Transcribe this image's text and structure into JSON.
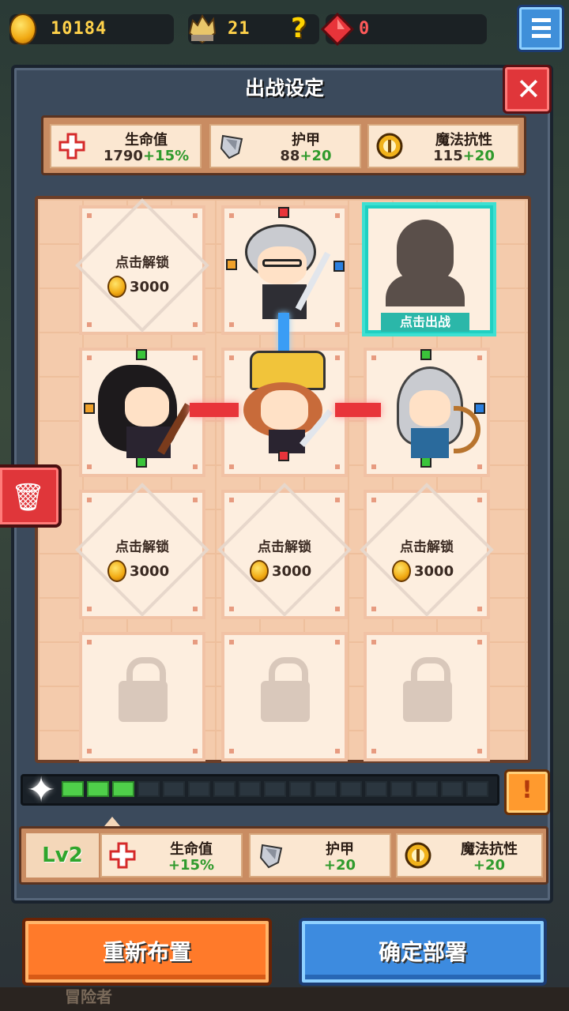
{
  "resources": {
    "gold": "10184",
    "crystals": "21",
    "unknown_icon": "?",
    "gems": "0"
  },
  "icons": {
    "coin": "coin-icon",
    "crystal": "crystal-icon",
    "question": "question-icon",
    "gem": "gem-icon",
    "menu": "menu-icon",
    "close": "close-icon",
    "health": "health-cross-icon",
    "armor": "shield-icon",
    "magic_resist": "magic-resist-icon",
    "trash": "trash-icon",
    "lock": "lock-icon",
    "warning": "warning-icon",
    "star": "sparkle-icon"
  },
  "title": "出战设定",
  "stats": [
    {
      "name": "生命值",
      "value": "1790",
      "bonus": "+15%"
    },
    {
      "name": "护甲",
      "value": "88",
      "bonus": "+20"
    },
    {
      "name": "魔法抗性",
      "value": "115",
      "bonus": "+20"
    }
  ],
  "grid": {
    "unlock_text": "点击解锁",
    "unlock_cost": "3000",
    "deploy_text": "点击出战"
  },
  "progress": {
    "filled_segments": 3,
    "total_segments": 17
  },
  "level_bonus": {
    "level": "Lv2",
    "stats": [
      {
        "name": "生命值",
        "bonus": "+15%"
      },
      {
        "name": "护甲",
        "bonus": "+20"
      },
      {
        "name": "魔法抗性",
        "bonus": "+20"
      }
    ]
  },
  "buttons": {
    "reset": "重新布置",
    "confirm": "确定部署"
  },
  "bottom_hint": "冒险者",
  "colors": {
    "green_bonus": "#2f9a2c",
    "close_red": "#e0363a",
    "confirm_blue": "#3d8bdf",
    "reset_orange": "#ff7a2a",
    "deploy_cyan": "#2bb7a9"
  }
}
